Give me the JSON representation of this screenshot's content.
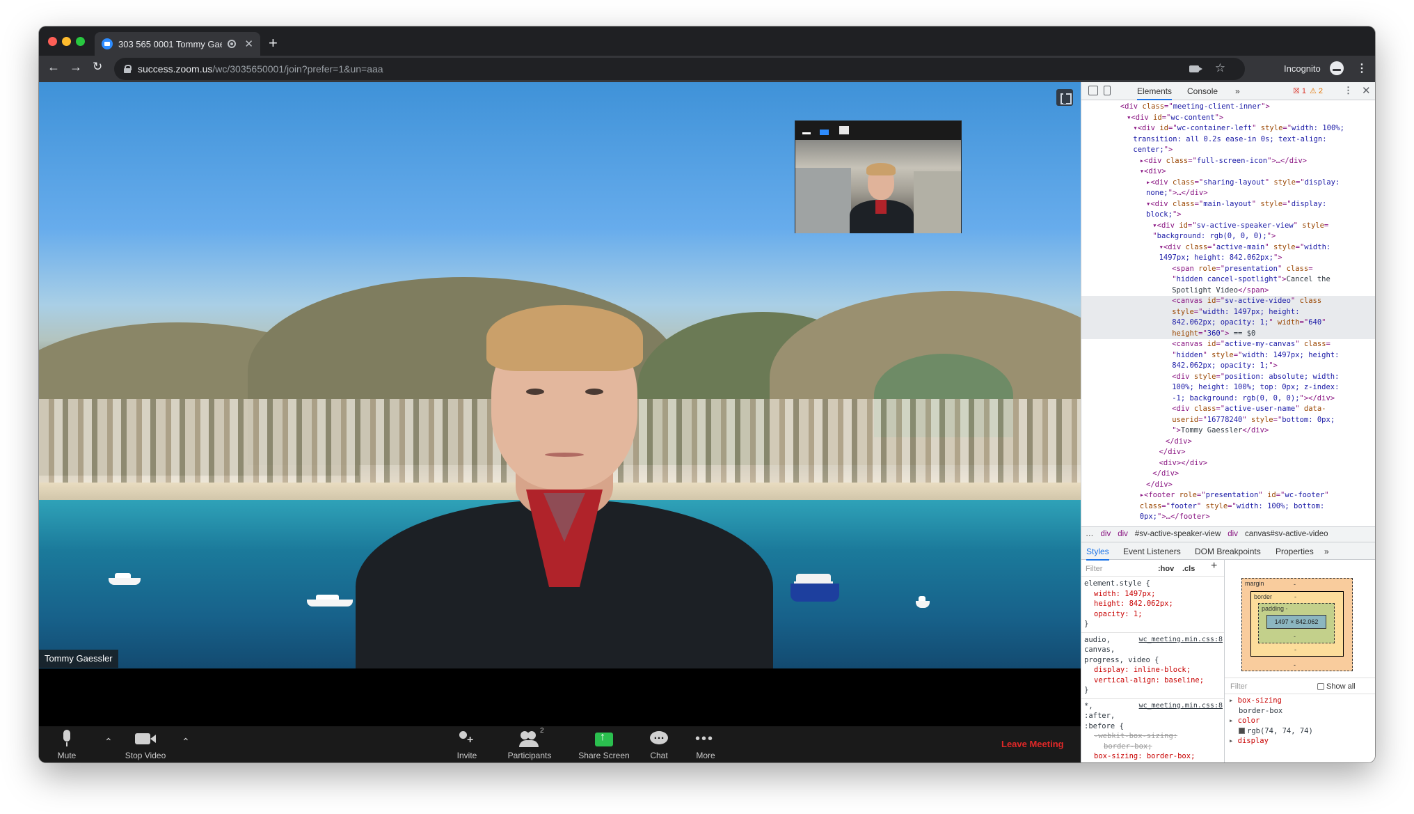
{
  "browser": {
    "tab_title": "303 565 0001 Tommy Gae",
    "url_host": "success.zoom.us",
    "url_path": "/wc/3035650001/join?prefer=1&un=aaa",
    "incognito_label": "Incognito"
  },
  "meeting": {
    "active_speaker": "Tommy Gaessler",
    "controls": {
      "mute": "Mute",
      "stop_video": "Stop Video",
      "invite": "Invite",
      "participants": "Participants",
      "participants_count": "2",
      "share_screen": "Share Screen",
      "chat": "Chat",
      "more": "More",
      "leave": "Leave Meeting"
    }
  },
  "devtools": {
    "tabs": [
      "Elements",
      "Console"
    ],
    "more_tabs": "»",
    "error_count": "1",
    "warning_count": "2",
    "dom_lines": [
      {
        "indent": 6,
        "html": "<span class='t-tag'>&lt;div</span> <span class='t-attr'>class</span>=\"<span class='t-val'>meeting-client-inner</span>\"<span class='t-tag'>&gt;</span>"
      },
      {
        "indent": 7,
        "html": "▾<span class='t-tag'>&lt;div</span> <span class='t-attr'>id</span>=\"<span class='t-val'>wc-content</span>\"<span class='t-tag'>&gt;</span>"
      },
      {
        "indent": 8,
        "html": "▾<span class='t-tag'>&lt;div</span> <span class='t-attr'>id</span>=\"<span class='t-val'>wc-container-left</span>\" <span class='t-attr'>style</span>=\"<span class='t-val'>width: 100%;</span>"
      },
      {
        "indent": 8,
        "html": "<span class='t-val'>transition: all 0.2s ease-in 0s; text-align:</span>"
      },
      {
        "indent": 8,
        "html": "<span class='t-val'>center;</span>\"<span class='t-tag'>&gt;</span>"
      },
      {
        "indent": 9,
        "html": "▸<span class='t-tag'>&lt;div</span> <span class='t-attr'>class</span>=\"<span class='t-val'>full-screen-icon</span>\"<span class='t-tag'>&gt;</span>…<span class='t-tag'>&lt;/div&gt;</span>"
      },
      {
        "indent": 9,
        "html": "▾<span class='t-tag'>&lt;div&gt;</span>"
      },
      {
        "indent": 10,
        "html": "▸<span class='t-tag'>&lt;div</span> <span class='t-attr'>class</span>=\"<span class='t-val'>sharing-layout</span>\" <span class='t-attr'>style</span>=\"<span class='t-val'>display:</span>"
      },
      {
        "indent": 10,
        "html": "<span class='t-val'>none;</span>\"<span class='t-tag'>&gt;</span>…<span class='t-tag'>&lt;/div&gt;</span>"
      },
      {
        "indent": 10,
        "html": "▾<span class='t-tag'>&lt;div</span> <span class='t-attr'>class</span>=\"<span class='t-val'>main-layout</span>\" <span class='t-attr'>style</span>=\"<span class='t-val'>display:</span>"
      },
      {
        "indent": 10,
        "html": "<span class='t-val'>block;</span>\"<span class='t-tag'>&gt;</span>"
      },
      {
        "indent": 11,
        "html": "▾<span class='t-tag'>&lt;div</span> <span class='t-attr'>id</span>=\"<span class='t-val'>sv-active-speaker-view</span>\" <span class='t-attr'>style</span>="
      },
      {
        "indent": 11,
        "html": "\"<span class='t-val'>background: rgb(0, 0, 0);</span>\"<span class='t-tag'>&gt;</span>"
      },
      {
        "indent": 12,
        "html": "▾<span class='t-tag'>&lt;div</span> <span class='t-attr'>class</span>=\"<span class='t-val'>active-main</span>\" <span class='t-attr'>style</span>=\"<span class='t-val'>width:</span>"
      },
      {
        "indent": 12,
        "html": "<span class='t-val'>1497px; height: 842.062px;</span>\"<span class='t-tag'>&gt;</span>"
      },
      {
        "indent": 14,
        "html": "<span class='t-tag'>&lt;span</span> <span class='t-attr'>role</span>=\"<span class='t-val'>presentation</span>\" <span class='t-attr'>class</span>="
      },
      {
        "indent": 14,
        "html": "\"<span class='t-val'>hidden cancel-spotlight</span>\"<span class='t-tag'>&gt;</span><span class='t-text'>Cancel the</span>"
      },
      {
        "indent": 14,
        "html": "<span class='t-text'>Spotlight Video</span><span class='t-tag'>&lt;/span&gt;</span>"
      },
      {
        "indent": 14,
        "html": "<span class='t-tag'>&lt;canvas</span> <span class='t-attr'>id</span>=\"<span class='t-val'>sv-active-video</span>\" <span class='t-attr'>class</span>",
        "sel": true
      },
      {
        "indent": 14,
        "html": "<span class='t-attr'>style</span>=\"<span class='t-val'>width: 1497px; height:</span>",
        "sel": true
      },
      {
        "indent": 14,
        "html": "<span class='t-val'>842.062px; opacity: 1;</span>\" <span class='t-attr'>width</span>=\"<span class='t-val'>640</span>\"",
        "sel": true
      },
      {
        "indent": 14,
        "html": "<span class='t-attr'>height</span>=\"<span class='t-val'>360</span>\"<span class='t-tag'>&gt;</span> <span class='t-text'>== $0</span>",
        "sel": true
      },
      {
        "indent": 14,
        "html": "<span class='t-tag'>&lt;canvas</span> <span class='t-attr'>id</span>=\"<span class='t-val'>active-my-canvas</span>\" <span class='t-attr'>class</span>="
      },
      {
        "indent": 14,
        "html": "\"<span class='t-val'>hidden</span>\" <span class='t-attr'>style</span>=\"<span class='t-val'>width: 1497px; height:</span>"
      },
      {
        "indent": 14,
        "html": "<span class='t-val'>842.062px; opacity: 1;</span>\"<span class='t-tag'>&gt;</span>"
      },
      {
        "indent": 14,
        "html": "<span class='t-tag'>&lt;div</span> <span class='t-attr'>style</span>=\"<span class='t-val'>position: absolute; width:</span>"
      },
      {
        "indent": 14,
        "html": "<span class='t-val'>100%; height: 100%; top: 0px; z-index:</span>"
      },
      {
        "indent": 14,
        "html": "<span class='t-val'>-1; background: rgb(0, 0, 0);</span>\"<span class='t-tag'>&gt;&lt;/div&gt;</span>"
      },
      {
        "indent": 14,
        "html": "<span class='t-tag'>&lt;div</span> <span class='t-attr'>class</span>=\"<span class='t-val'>active-user-name</span>\" <span class='t-attr'>data-</span>"
      },
      {
        "indent": 14,
        "html": "<span class='t-attr'>userid</span>=\"<span class='t-val'>16778240</span>\" <span class='t-attr'>style</span>=\"<span class='t-val'>bottom: 0px;</span>"
      },
      {
        "indent": 14,
        "html": "\"<span class='t-tag'>&gt;</span><span class='t-text'>Tommy Gaessler</span><span class='t-tag'>&lt;/div&gt;</span>"
      },
      {
        "indent": 13,
        "html": "<span class='t-tag'>&lt;/div&gt;</span>"
      },
      {
        "indent": 12,
        "html": "<span class='t-tag'>&lt;/div&gt;</span>"
      },
      {
        "indent": 12,
        "html": "<span class='t-tag'>&lt;div&gt;&lt;/div&gt;</span>"
      },
      {
        "indent": 11,
        "html": "<span class='t-tag'>&lt;/div&gt;</span>"
      },
      {
        "indent": 10,
        "html": "<span class='t-tag'>&lt;/div&gt;</span>"
      },
      {
        "indent": 9,
        "html": "▸<span class='t-tag'>&lt;footer</span> <span class='t-attr'>role</span>=\"<span class='t-val'>presentation</span>\" <span class='t-attr'>id</span>=\"<span class='t-val'>wc-footer</span>\""
      },
      {
        "indent": 9,
        "html": "<span class='t-attr'>class</span>=\"<span class='t-val'>footer</span>\" <span class='t-attr'>style</span>=\"<span class='t-val'>width: 100%; bottom:</span>"
      },
      {
        "indent": 9,
        "html": "<span class='t-val'>0px;</span>\"<span class='t-tag'>&gt;</span>…<span class='t-tag'>&lt;/footer&gt;</span>"
      }
    ],
    "breadcrumbs": [
      "…",
      "div",
      "div",
      "#sv-active-speaker-view",
      "div",
      "canvas#sv-active-video"
    ],
    "subtabs": [
      "Styles",
      "Event Listeners",
      "DOM Breakpoints",
      "Properties",
      "»"
    ],
    "styles": {
      "filter_placeholder": "Filter",
      "hov": ":hov",
      "cls": ".cls",
      "rule1_selector": "element.style {",
      "rule1_props": [
        "width: 1497px;",
        "height: 842.062px;",
        "opacity: 1;"
      ],
      "rule2_source": "wc_meeting.min.css:8",
      "rule2_selector_lines": [
        "audio,",
        "canvas,",
        "progress, video {"
      ],
      "rule2_props": [
        "display: inline-block;",
        "vertical-align: baseline;"
      ],
      "rule3_source": "wc_meeting.min.css:8",
      "rule3_selector_lines": [
        "*,",
        ":after,",
        ":before {"
      ],
      "rule3_struck": [
        "-webkit-box-sizing:",
        "border-box;"
      ],
      "rule3_props": [
        "box-sizing: border-box;"
      ],
      "close_brace": "}"
    },
    "box_model": {
      "margin_label": "margin",
      "border_label": "border",
      "padding_label": "padding -",
      "content_size": "1497 × 842.062",
      "dash": "-"
    },
    "computed": {
      "filter_placeholder": "Filter",
      "show_all": "Show all",
      "props": [
        {
          "name": "box-sizing",
          "value": "border-box"
        },
        {
          "name": "color",
          "value": "rgb(74, 74, 74)"
        },
        {
          "name": "display",
          "value": ""
        }
      ]
    }
  },
  "colors": {
    "zoom_blue": "#2d8cff",
    "share_green": "#2bbf4f",
    "leave_red": "#e02828"
  }
}
